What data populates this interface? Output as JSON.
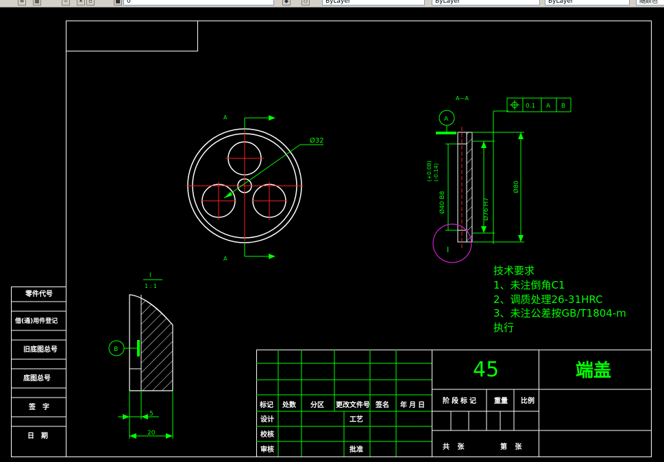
{
  "toolbar": {
    "layer_select": "0",
    "layout_tab_1": "ByLayer",
    "layout_tab_2": "ByLayer",
    "layout_tab_3": "ByLayer",
    "right_combo": "随颜色"
  },
  "drawing": {
    "section_label": "A—A",
    "section_mark_top": "A",
    "section_mark_bottom": "A",
    "dim_phi32": "Ø32",
    "datum_a": "A",
    "datum_b": "B",
    "detail_callout": "I",
    "detail_title": "I",
    "detail_scale": "1 : 1",
    "tolerance_frame": {
      "value": "0.1",
      "datum1": "A",
      "datum2": "B"
    },
    "dim_phi80": "Ø80",
    "dim_phi40": "Ø40 B8",
    "dim_tol_upper": "(+0.08)",
    "dim_tol_lower": "(-0.14)",
    "dim_phi76": "Ø76 H7",
    "dim_5": "5",
    "dim_20": "20"
  },
  "notes": {
    "title": "技术要求",
    "items": [
      "1、未注倒角C1",
      "2、调质处理26-31HRC",
      "3、未注公差按GB/T1804-m",
      "执行"
    ]
  },
  "title_block": {
    "material": "45",
    "part_name": "端盖",
    "header_labels": [
      "标记",
      "处数",
      "分区",
      "更改文件号",
      "签名",
      "年月日"
    ],
    "stage_label": "阶段标记",
    "weight_label": "重量",
    "scale_label": "比例",
    "design_label": "设计",
    "process_label": "工艺",
    "check_label": "校核",
    "review_label": "审核",
    "approve_label": "批准",
    "sheet_total": "共 张",
    "sheet_no": "第 张"
  },
  "side_table": [
    "零件代号",
    "借(通)用件登记",
    "旧底图总号",
    "底图总号",
    "签字",
    "日期"
  ]
}
